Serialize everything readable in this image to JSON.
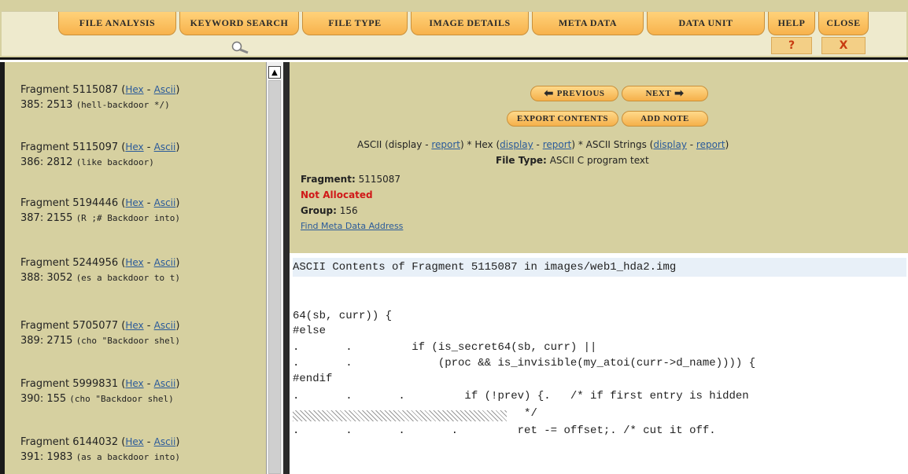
{
  "toolbar": {
    "tabs": [
      {
        "label": "File Analysis"
      },
      {
        "label": "Keyword Search"
      },
      {
        "label": "File Type"
      },
      {
        "label": "Image Details"
      },
      {
        "label": "Meta Data"
      },
      {
        "label": "Data Unit"
      },
      {
        "label": "Help",
        "icon": "?"
      },
      {
        "label": "Close",
        "icon": "X"
      }
    ]
  },
  "fragments": [
    {
      "title": "Fragment 5115087",
      "hex": "Hex",
      "ascii": "Ascii",
      "idx": "385: 2513",
      "snippet": "(hell-backdoor */)"
    },
    {
      "title": "Fragment 5115097",
      "hex": "Hex",
      "ascii": "Ascii",
      "idx": "386: 2812",
      "snippet": "(like backdoor)"
    },
    {
      "title": "Fragment 5194446",
      "hex": "Hex",
      "ascii": "Ascii",
      "idx": "387: 2155",
      "snippet": "(R ;# Backdoor into)"
    },
    {
      "title": "Fragment 5244956",
      "hex": "Hex",
      "ascii": "Ascii",
      "idx": "388: 3052",
      "snippet": "(es a backdoor to t)"
    },
    {
      "title": "Fragment 5705077",
      "hex": "Hex",
      "ascii": "Ascii",
      "idx": "389: 2715",
      "snippet": "(cho \"Backdoor shel)"
    },
    {
      "title": "Fragment 5999831",
      "hex": "Hex",
      "ascii": "Ascii",
      "idx": "390: 155",
      "snippet": "(cho \"Backdoor shel)"
    },
    {
      "title": "Fragment 6144032",
      "hex": "Hex",
      "ascii": "Ascii",
      "idx": "391: 1983",
      "snippet": "(as a backdoor into)"
    }
  ],
  "nav": {
    "previous": "Previous",
    "next": "Next",
    "export": "Export Contents",
    "add_note": "Add Note"
  },
  "views": {
    "ascii_prefix": "ASCII (display - ",
    "report": "report",
    "hex_prefix": ") * Hex (",
    "display": "display",
    "sep": " - ",
    "strings_prefix": ") * ASCII Strings (",
    "end": ")"
  },
  "file_type": {
    "label": "File Type:",
    "value": "ASCII C program text"
  },
  "fragment_info": {
    "label": "Fragment:",
    "value": "5115087",
    "status": "Not Allocated",
    "group_label": "Group:",
    "group_value": "156",
    "find_link": "Find Meta Data Address"
  },
  "content": {
    "header": "ASCII Contents of Fragment 5115087 in images/web1_hda2.img",
    "lines": [
      "64(sb, curr)) {",
      "#else",
      ".       .         if (is_secret64(sb, curr) ||",
      ".       .             (proc && is_invisible(my_atoi(curr->d_name)))) {",
      "#endif",
      ".       .       .         if (!prev) {.   /* if first entry is hidden",
      "                                   */",
      ".       .       .       .         ret -= offset;. /* cut it off."
    ]
  }
}
